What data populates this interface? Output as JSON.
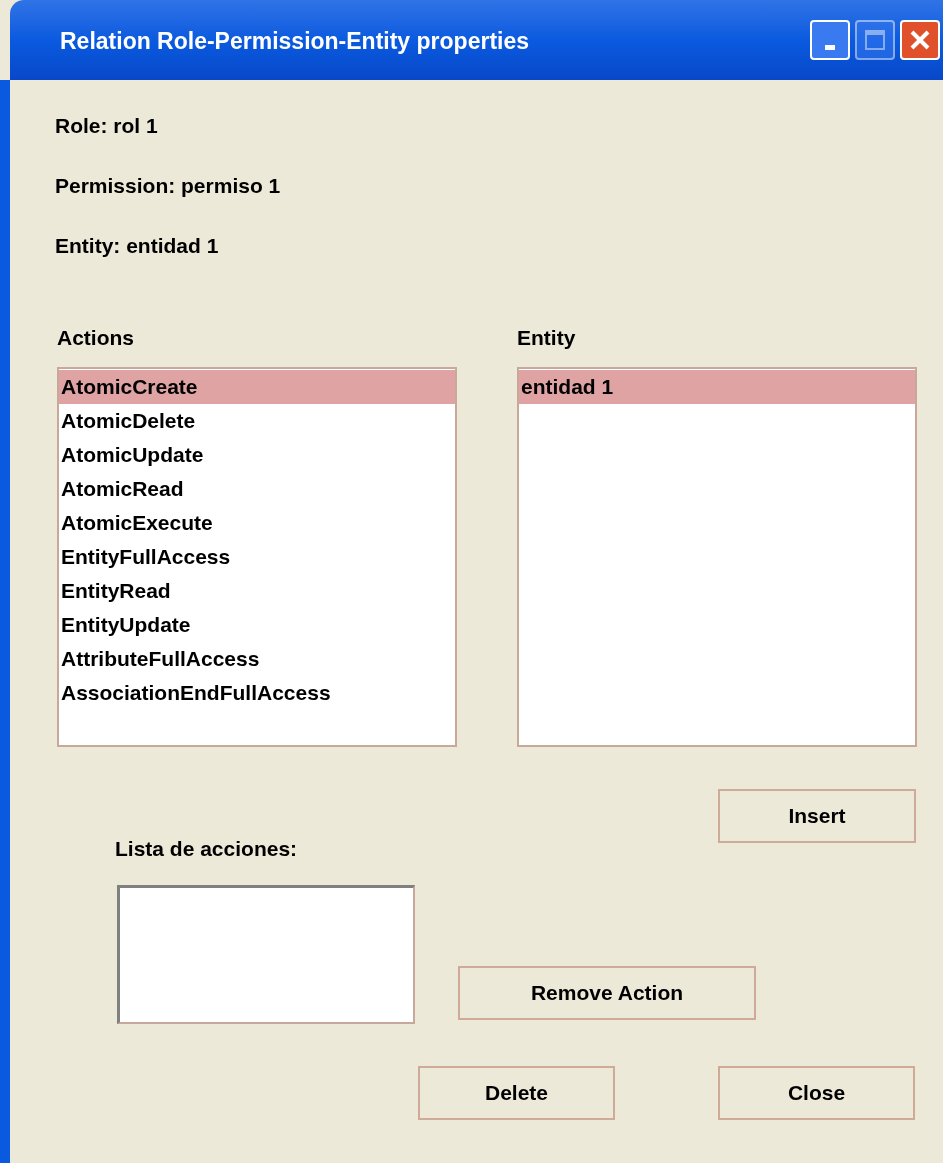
{
  "window": {
    "title": "Relation Role-Permission-Entity properties",
    "controls": [
      {
        "kind": "minimize",
        "disabled": false
      },
      {
        "kind": "maximize",
        "disabled": true
      },
      {
        "kind": "close",
        "disabled": false
      }
    ]
  },
  "info": [
    "Role: rol 1",
    "Permission: permiso 1",
    "Entity: entidad 1"
  ],
  "actions": {
    "label": "Actions",
    "items": [
      {
        "label": "AtomicCreate",
        "selected": true
      },
      {
        "label": "AtomicDelete",
        "selected": false
      },
      {
        "label": "AtomicUpdate",
        "selected": false
      },
      {
        "label": "AtomicRead",
        "selected": false
      },
      {
        "label": "AtomicExecute",
        "selected": false
      },
      {
        "label": "EntityFullAccess",
        "selected": false
      },
      {
        "label": "EntityRead",
        "selected": false
      },
      {
        "label": "EntityUpdate",
        "selected": false
      },
      {
        "label": "AttributeFullAccess",
        "selected": false
      },
      {
        "label": "AssociationEndFullAccess",
        "selected": false
      }
    ]
  },
  "entity": {
    "label": "Entity",
    "items": [
      {
        "label": "entidad 1",
        "selected": true
      }
    ]
  },
  "insert_button": "Insert",
  "action_list": {
    "label": "Lista de acciones:"
  },
  "remove_button": "Remove Action",
  "buttons": [
    "Delete",
    "Close"
  ]
}
